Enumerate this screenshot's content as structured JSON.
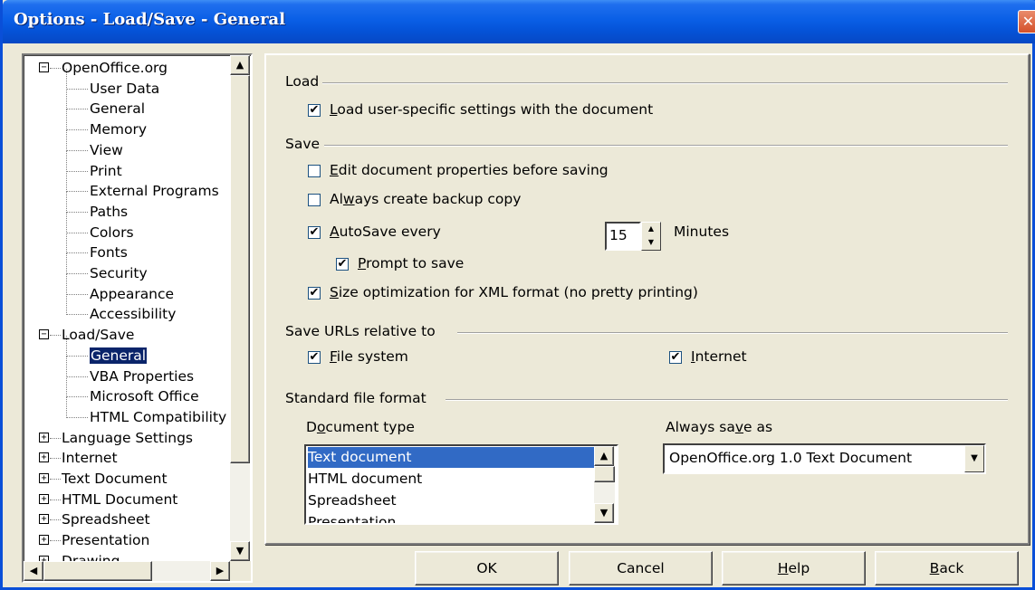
{
  "window": {
    "title": "Options - Load/Save - General",
    "close_glyph": "✕"
  },
  "tree": {
    "items": [
      {
        "label": "OpenOffice.org",
        "expander": "−"
      },
      {
        "label": "User Data"
      },
      {
        "label": "General"
      },
      {
        "label": "Memory"
      },
      {
        "label": "View"
      },
      {
        "label": "Print"
      },
      {
        "label": "External Programs"
      },
      {
        "label": "Paths"
      },
      {
        "label": "Colors"
      },
      {
        "label": "Fonts"
      },
      {
        "label": "Security"
      },
      {
        "label": "Appearance"
      },
      {
        "label": "Accessibility"
      },
      {
        "label": "Load/Save",
        "expander": "−"
      },
      {
        "label": "General"
      },
      {
        "label": "VBA Properties"
      },
      {
        "label": "Microsoft Office"
      },
      {
        "label": "HTML Compatibility"
      },
      {
        "label": "Language Settings",
        "expander": "+"
      },
      {
        "label": "Internet",
        "expander": "+"
      },
      {
        "label": "Text Document",
        "expander": "+"
      },
      {
        "label": "HTML Document",
        "expander": "+"
      },
      {
        "label": "Spreadsheet",
        "expander": "+"
      },
      {
        "label": "Presentation",
        "expander": "+"
      },
      {
        "label": "Drawing",
        "expander": "+"
      }
    ],
    "selected_item": "General"
  },
  "load": {
    "heading": "Load",
    "user_settings": {
      "mnemonic": "L",
      "rest": "oad user-specific settings with the document",
      "checked": true
    }
  },
  "save": {
    "heading": "Save",
    "edit_props": {
      "mnemonic": "E",
      "rest": "dit document properties before saving",
      "checked": false
    },
    "backup": {
      "pre": "Al",
      "mnemonic": "w",
      "rest": "ays create backup copy",
      "checked": false
    },
    "autosave": {
      "mnemonic": "A",
      "rest": "utoSave every",
      "checked": true,
      "minutes_value": "15",
      "minutes_label": "Minutes"
    },
    "prompt": {
      "mnemonic": "P",
      "rest": "rompt to save",
      "checked": true
    },
    "size_opt": {
      "mnemonic": "S",
      "rest": "ize optimization for XML format (no pretty printing)",
      "checked": true
    }
  },
  "urls": {
    "heading": "Save URLs relative to",
    "file_system": {
      "mnemonic": "F",
      "rest": "ile system",
      "checked": true
    },
    "internet": {
      "mnemonic": "I",
      "rest": "nternet",
      "checked": true
    }
  },
  "format": {
    "heading": "Standard file format",
    "doc_type_label_pre": "D",
    "doc_type_label_mnemonic": "o",
    "doc_type_label_rest": "cument type",
    "doc_types": [
      "Text document",
      "HTML document",
      "Spreadsheet",
      "Presentation"
    ],
    "selected_doc_type": "Text document",
    "save_as_label_pre": "Always sa",
    "save_as_label_mnemonic": "v",
    "save_as_label_rest": "e as",
    "save_as_value": "OpenOffice.org 1.0 Text Document"
  },
  "buttons": {
    "ok": "OK",
    "cancel": "Cancel",
    "help_mnemonic": "H",
    "help_rest": "elp",
    "back_mnemonic": "B",
    "back_rest": "ack"
  },
  "check_glyph": "✔"
}
